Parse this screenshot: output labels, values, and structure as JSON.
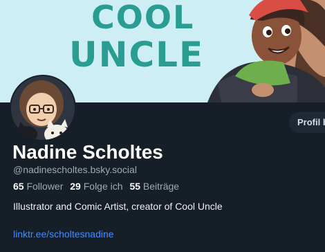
{
  "banner": {
    "line1": "COOL",
    "line2": "UNCLE",
    "title_color": "#2a9d92",
    "background_color": "#cdeef5"
  },
  "profile": {
    "display_name": "Nadine Scholtes",
    "handle": "@nadinescholtes.bsky.social",
    "button_label": "Profil b",
    "stats": [
      {
        "value": "65",
        "label": "Follower"
      },
      {
        "value": "29",
        "label": "Folge ich"
      },
      {
        "value": "55",
        "label": "Beiträge"
      }
    ],
    "bio": "Illustrator and Comic Artist, creator of Cool Uncle",
    "link": "linktr.ee/scholtesnadine"
  },
  "colors": {
    "page_background": "#161e27",
    "link": "#3d8eff",
    "muted_text": "#a0aab5"
  },
  "icons": {
    "avatar": "illustrated-portrait-with-glasses-and-cat"
  }
}
